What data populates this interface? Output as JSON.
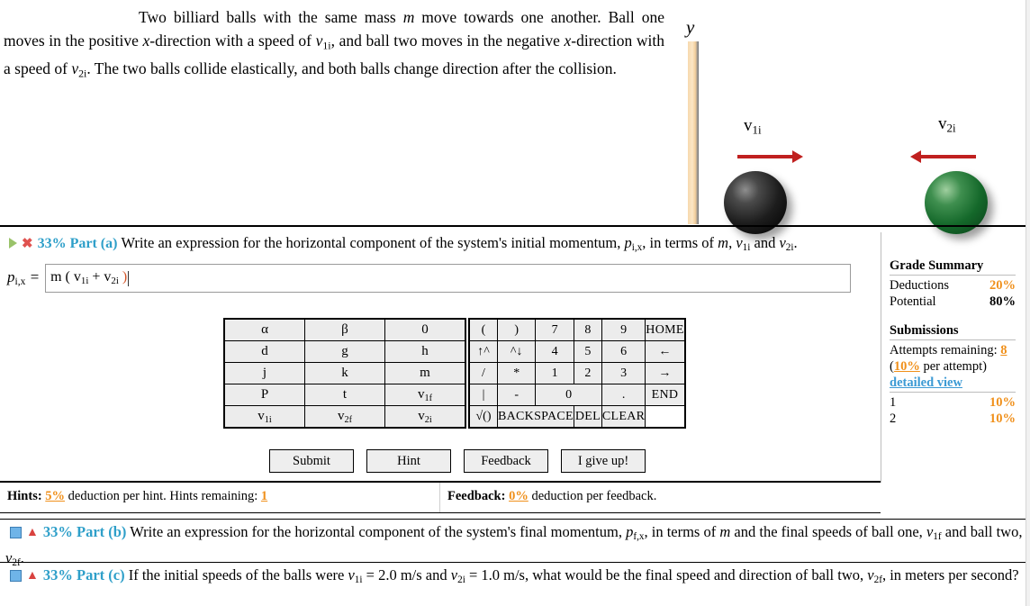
{
  "problem": {
    "text_html": "Two billiard balls with the same mass <i>m</i> move towards one another. Ball one moves in the positive <i>x</i>-direction with a speed of <i>v</i><sub>1i</sub>, and ball two moves in the negative <i>x</i>-direction with a speed of <i>v</i><sub>2i</sub>. The two balls collide elastically, and both balls change direction after the collision."
  },
  "figure": {
    "y_axis_label": "y",
    "ball_one": {
      "name": "black-ball",
      "color": "#1d1d1d",
      "velocity_label": "v1i",
      "arrow_direction": "right",
      "arrow_color": "#c0201f"
    },
    "ball_two": {
      "name": "green-ball",
      "color": "#14682a",
      "velocity_label": "v2i",
      "arrow_direction": "left",
      "arrow_color": "#c0201f"
    }
  },
  "part_a": {
    "status_icons": [
      "play-triangle",
      "red-x"
    ],
    "percent": "33%",
    "part_label": "Part (a)",
    "prompt_html": "Write an expression for the horizontal component of the system's initial momentum, <i>p</i><sub>i,x</sub>, in terms of <i>m</i>, <i>v</i><sub>1i</sub> and <i>v</i><sub>2i</sub>.",
    "answer_label_html": "<i>p</i><sub>i,x</sub> =",
    "answer_value_html": "m ( v<sub>1i</sub> + v<sub>2i</sub> <span class=\"paren-hl\">)</span>",
    "answer_value_plain": "m ( v1i + v2i )"
  },
  "keypad": {
    "left_rows": [
      [
        "α",
        "β",
        "0"
      ],
      [
        "d",
        "g",
        "h"
      ],
      [
        "j",
        "k",
        "m"
      ],
      [
        "P",
        "t",
        "v1f"
      ],
      [
        "v1i",
        "v2f",
        "v2i"
      ]
    ],
    "right_rows": [
      [
        {
          "label": "(",
          "state": "enabled",
          "kind": "op"
        },
        {
          "label": ")",
          "state": "disabled",
          "kind": "op"
        },
        {
          "label": "7",
          "state": "enabled",
          "kind": "num"
        },
        {
          "label": "8",
          "state": "enabled",
          "kind": "num"
        },
        {
          "label": "9",
          "state": "enabled",
          "kind": "num"
        },
        {
          "label": "HOME",
          "state": "enabled",
          "kind": "cmd"
        }
      ],
      [
        {
          "label": "↑^",
          "state": "enabled",
          "kind": "op"
        },
        {
          "label": "^↓",
          "state": "disabled",
          "kind": "op"
        },
        {
          "label": "4",
          "state": "enabled",
          "kind": "num"
        },
        {
          "label": "5",
          "state": "enabled",
          "kind": "num"
        },
        {
          "label": "6",
          "state": "enabled",
          "kind": "num"
        },
        {
          "label": "←",
          "state": "enabled",
          "kind": "cmd"
        }
      ],
      [
        {
          "label": "/",
          "state": "enabled",
          "kind": "op"
        },
        {
          "label": "*",
          "state": "disabled",
          "kind": "op"
        },
        {
          "label": "1",
          "state": "enabled",
          "kind": "num"
        },
        {
          "label": "2",
          "state": "enabled",
          "kind": "num"
        },
        {
          "label": "3",
          "state": "enabled",
          "kind": "num"
        },
        {
          "label": "→",
          "state": "enabled",
          "kind": "cmd"
        }
      ],
      [
        {
          "label": "|",
          "state": "enabled",
          "kind": "op"
        },
        {
          "label": "-",
          "state": "enabled",
          "kind": "op"
        },
        {
          "label": "0",
          "state": "enabled",
          "kind": "num"
        },
        {
          "label": ".",
          "state": "enabled",
          "kind": "num"
        },
        {
          "label": "END",
          "state": "enabled",
          "kind": "cmd"
        }
      ],
      [
        {
          "label": "√()",
          "state": "enabled",
          "kind": "op"
        },
        {
          "label": "BACKSPACE",
          "state": "enabled",
          "kind": "cmd"
        },
        {
          "label": "DEL",
          "state": "enabled",
          "kind": "cmd"
        },
        {
          "label": "CLEAR",
          "state": "enabled",
          "kind": "cmd"
        }
      ]
    ]
  },
  "buttons": {
    "submit": "Submit",
    "hint": "Hint",
    "feedback": "Feedback",
    "give_up": "I give up!"
  },
  "hints_bar": {
    "hints_label": "Hints:",
    "hints_deduction": "5%",
    "hints_text_1": "deduction per hint. Hints remaining:",
    "hints_remaining": "1",
    "feedback_label": "Feedback:",
    "feedback_deduction": "0%",
    "feedback_text": "deduction per feedback."
  },
  "grade_summary": {
    "title": "Grade Summary",
    "deductions_label": "Deductions",
    "deductions_value": "20%",
    "potential_label": "Potential",
    "potential_value": "80%",
    "submissions_title": "Submissions",
    "attempts_label": "Attempts remaining:",
    "attempts_value": "8",
    "per_attempt_open": "(",
    "per_attempt_pct": "10%",
    "per_attempt_close": " per attempt)",
    "detailed_view": "detailed view",
    "rows": [
      {
        "n": "1",
        "pct": "10%"
      },
      {
        "n": "2",
        "pct": "10%"
      }
    ]
  },
  "part_b": {
    "status_icons": [
      "blue-square",
      "warning-triangle"
    ],
    "percent": "33%",
    "part_label": "Part (b)",
    "prompt_html": "Write an expression for the horizontal component of the system's final momentum, <i>p</i><sub>f,x</sub>, in terms of <i>m</i> and the final speeds of ball one, <i>v</i><sub>1f</sub> and ball two, <i>v</i><sub>2f</sub>."
  },
  "part_c": {
    "status_icons": [
      "blue-square",
      "warning-triangle"
    ],
    "percent": "33%",
    "part_label": "Part (c)",
    "prompt_html": "If the initial speeds of the balls were <i>v</i><sub>1i</sub> = 2.0 m/s and <i>v</i><sub>2i</sub> = 1.0 m/s, what would be the final speed and direction of ball two, <i>v</i><sub>2f</sub>, in meters per second?"
  },
  "colors": {
    "accent_blue": "#2e9fc9",
    "accent_orange": "#f0901b",
    "error_red": "#d9423f",
    "arrow_red": "#c0201f"
  }
}
